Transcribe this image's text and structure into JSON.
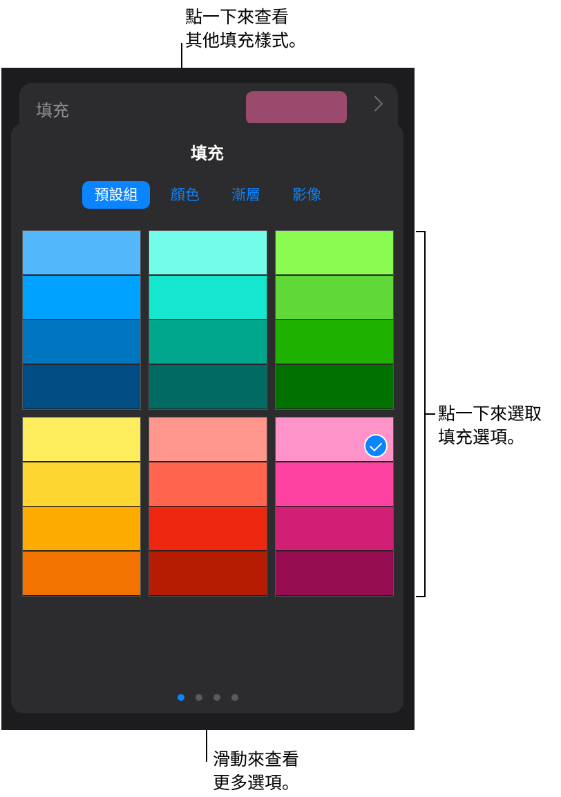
{
  "callouts": {
    "top_line1": "點一下來查看",
    "top_line2": "其他填充樣式。",
    "right_line1": "點一下來選取",
    "right_line2": "填充選項。",
    "bottom_line1": "滑動來查看",
    "bottom_line2": "更多選項。"
  },
  "fill_row": {
    "label": "填充",
    "swatch_color": "#9a4a6c"
  },
  "popover": {
    "title": "填充",
    "tabs": [
      {
        "label": "預設組",
        "active": true
      },
      {
        "label": "顏色",
        "active": false
      },
      {
        "label": "漸層",
        "active": false
      },
      {
        "label": "影像",
        "active": false
      }
    ],
    "presets": [
      {
        "colors": [
          "#53b8fb",
          "#00a2ff",
          "#0176c0",
          "#004c83"
        ],
        "selected": false
      },
      {
        "colors": [
          "#73fcea",
          "#15e6cf",
          "#00a78d",
          "#006a63"
        ],
        "selected": false
      },
      {
        "colors": [
          "#89fb51",
          "#60d838",
          "#1eb100",
          "#017100"
        ],
        "selected": false
      },
      {
        "colors": [
          "#fdec5b",
          "#fed632",
          "#feab00",
          "#f27300"
        ],
        "selected": false
      },
      {
        "colors": [
          "#fe968c",
          "#fe644e",
          "#ee2810",
          "#b51c01"
        ],
        "selected": false
      },
      {
        "colors": [
          "#fe93c9",
          "#fe42a1",
          "#d11f75",
          "#960e51"
        ],
        "selected": true
      }
    ],
    "page_dots": {
      "count": 4,
      "active_index": 0
    }
  }
}
